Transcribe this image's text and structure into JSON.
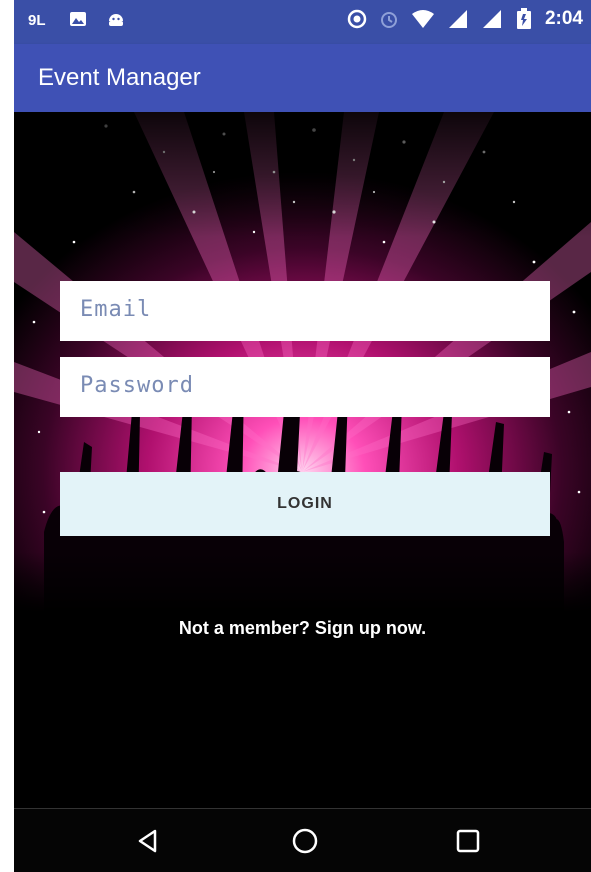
{
  "status_bar": {
    "left_icons": [
      "data-saver-icon",
      "photo-icon",
      "android-icon"
    ],
    "right_icons": [
      "location-icon",
      "alarm-icon",
      "wifi-icon",
      "signal-icon",
      "signal-icon-2",
      "battery-icon"
    ],
    "time": "2:04"
  },
  "app_bar": {
    "title": "Event Manager"
  },
  "login_form": {
    "email_placeholder": "Email",
    "password_placeholder": "Password",
    "login_label": "LOGIN",
    "signup_text": "Not a member? Sign up now."
  },
  "nav_bar": {
    "buttons": [
      "back-icon",
      "home-icon",
      "recents-icon"
    ]
  },
  "colors": {
    "primary": "#3f51b5",
    "primary_dark": "#3a4fa7",
    "button_bg": "#e3f3f8",
    "accent_pink": "#e0208a"
  }
}
